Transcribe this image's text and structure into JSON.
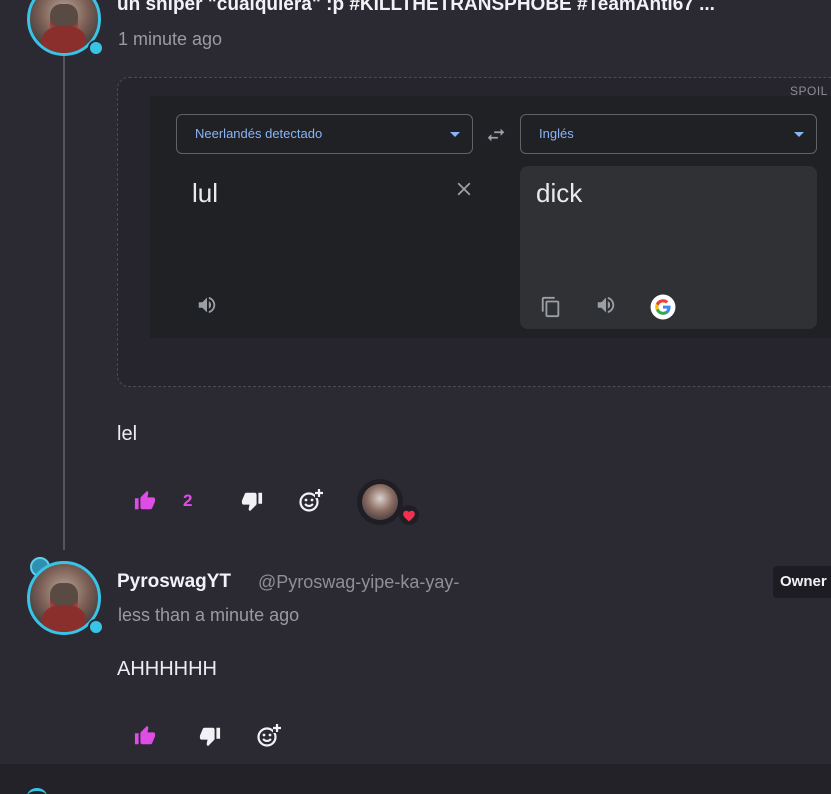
{
  "comment_1": {
    "header_text": "un sniper \"cualquiera\" :p #KILLTHETRANSPHOBE #TeamAnti67 ...",
    "timestamp": "1 minute ago",
    "embed": {
      "spoiler_label": "SPOIL",
      "source_language": "Neerlandés detectado",
      "target_language": "Inglés",
      "source_text": "lul",
      "translated_text": "dick",
      "icons": [
        "swap-icon",
        "clear-icon",
        "speaker-icon",
        "copy-icon",
        "speaker-icon",
        "google-icon"
      ]
    },
    "body": "lel",
    "likes": "2",
    "reaction": "heart"
  },
  "comment_2": {
    "display_name": "PyroswagYT",
    "handle": "@Pyroswag-yipe-ka-yay-",
    "badge": "Owner",
    "timestamp": "less than a minute ago",
    "body": "AHHHHHH"
  },
  "colors": {
    "background": "#2b2a33",
    "accent_like": "#e04de6",
    "avatar_ring": "#39c3e6",
    "translate_link": "#8ab4f8",
    "heart": "#f0304e"
  }
}
